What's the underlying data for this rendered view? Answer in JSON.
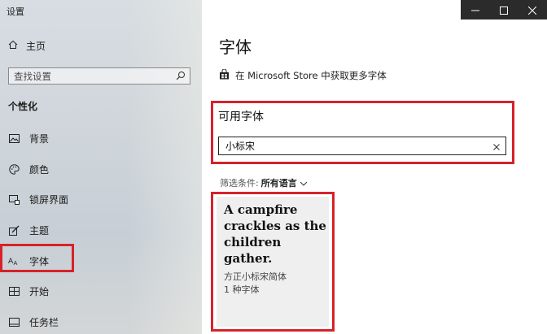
{
  "app_title": "设置",
  "sidebar": {
    "home": "主页",
    "search_placeholder": "查找设置",
    "section": "个性化",
    "items": [
      {
        "label": "背景",
        "icon": "picture-icon"
      },
      {
        "label": "颜色",
        "icon": "palette-icon"
      },
      {
        "label": "锁屏界面",
        "icon": "lock-screen-icon"
      },
      {
        "label": "主题",
        "icon": "theme-brush-icon"
      },
      {
        "label": "字体",
        "icon": "font-icon"
      },
      {
        "label": "开始",
        "icon": "start-icon"
      },
      {
        "label": "任务栏",
        "icon": "taskbar-icon"
      }
    ]
  },
  "main": {
    "title": "字体",
    "store_link": "在 Microsoft Store 中获取更多字体",
    "available_title": "可用字体",
    "search_value": "小标宋",
    "filter_label": "筛选条件:",
    "filter_value": "所有语言",
    "font_card": {
      "sample_text": "A campfire crackles as the children gather.",
      "font_name": "方正小标宋简体",
      "font_count": "1 种字体"
    }
  },
  "colors": {
    "highlight": "#d6222a",
    "titlebar": "#2b2b2b"
  }
}
